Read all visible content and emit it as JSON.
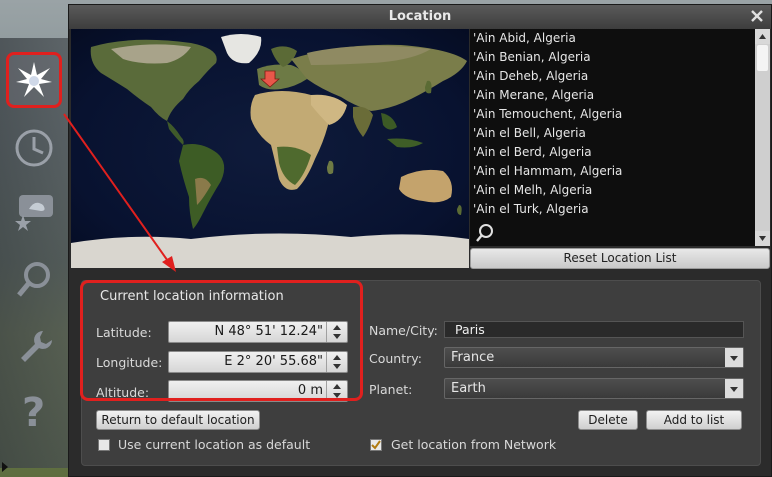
{
  "dialog": {
    "title": "Location"
  },
  "toolbar": {
    "items": [
      {
        "icon": "compass-star-icon",
        "active": true
      },
      {
        "icon": "clock-icon",
        "active": false
      },
      {
        "icon": "sky-view-icon",
        "active": false
      },
      {
        "icon": "search-magnifier-icon",
        "active": false
      },
      {
        "icon": "wrench-icon",
        "active": false
      },
      {
        "icon": "help-question-icon",
        "active": false
      }
    ]
  },
  "location_list": {
    "items": [
      "'Ain Abid, Algeria",
      "'Ain Benian, Algeria",
      "'Ain Deheb, Algeria",
      "'Ain Merane, Algeria",
      "'Ain Temouchent, Algeria",
      "'Ain el Bell, Algeria",
      "'Ain el Berd, Algeria",
      "'Ain el Hammam, Algeria",
      "'Ain el Melh, Algeria",
      "'Ain el Turk, Algeria"
    ],
    "reset_label": "Reset Location List"
  },
  "current": {
    "section_title": "Current location information",
    "latitude_label": "Latitude:",
    "latitude_value": "N 48° 51' 12.24\"",
    "longitude_label": "Longitude:",
    "longitude_value": "E 2° 20' 55.68\"",
    "altitude_label": "Altitude:",
    "altitude_value": "0 m",
    "name_label": "Name/City:",
    "name_value": "Paris",
    "country_label": "Country:",
    "country_value": "France",
    "planet_label": "Planet:",
    "planet_value": "Earth",
    "return_default_label": "Return to default location",
    "delete_label": "Delete",
    "add_label": "Add to list",
    "use_default_label": "Use current location as default",
    "use_default_checked": false,
    "network_label": "Get location from Network",
    "network_checked": true
  },
  "colors": {
    "annotation_red": "#e0201e",
    "marker_red": "#e8574a"
  }
}
